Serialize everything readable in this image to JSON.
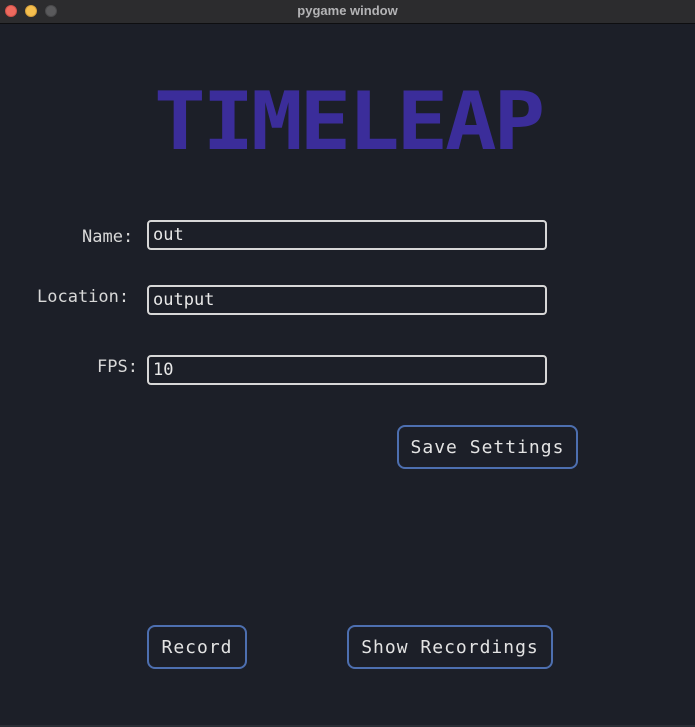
{
  "window": {
    "title": "pygame window"
  },
  "logo": {
    "text": "TIMELEAP",
    "color": "#3b2d9a"
  },
  "form": {
    "name_label": "Name:",
    "name_value": "out",
    "location_label": "Location:",
    "location_value": "output",
    "fps_label": "FPS:",
    "fps_value": "10"
  },
  "buttons": {
    "save_settings": "Save Settings",
    "record": "Record",
    "show_recordings": "Show Recordings"
  },
  "colors": {
    "background": "#1c1f28",
    "button_border": "#4d6fb0",
    "input_border": "#d7d7d7"
  }
}
